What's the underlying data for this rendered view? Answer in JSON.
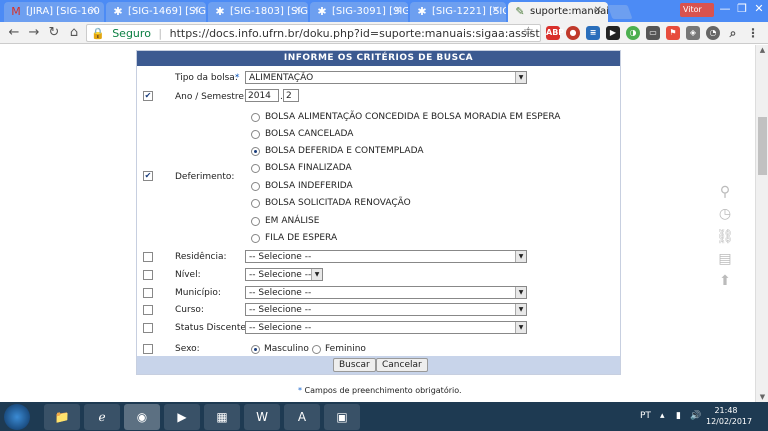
{
  "browser": {
    "tabs": [
      {
        "label": "[JIRA] [SIG-160",
        "icon": "gmail-icon",
        "active": false
      },
      {
        "label": "[SIG-1469] [SIG",
        "icon": "jira-icon",
        "active": false
      },
      {
        "label": "[SIG-1803] [SIG",
        "icon": "jira-icon",
        "active": false
      },
      {
        "label": "[SIG-3091] [SIG",
        "icon": "jira-icon",
        "active": false
      },
      {
        "label": "[SIG-1221] [SIG",
        "icon": "jira-icon",
        "active": false
      },
      {
        "label": "suporte:manuais",
        "icon": "doku-icon",
        "active": true
      }
    ],
    "profile_label": "Vitor",
    "secure_label": "Seguro",
    "url": "https://docs.info.ufrn.br/doku.php?id=suporte:manuais:sigaa:assistencia_ao_estudante"
  },
  "form": {
    "header": "INFORME OS CRITÉRIOS DE BUSCA",
    "tipo_bolsa": {
      "label": "Tipo da bolsa:",
      "value": "ALIMENTAÇÃO"
    },
    "ano_semestre": {
      "label": "Ano / Semestre:",
      "ano": "2014",
      "semestre": "2",
      "separator": ".",
      "checked": true
    },
    "deferimento": {
      "label": "Deferimento:",
      "checked": true,
      "options": [
        "BOLSA ALIMENTAÇÃO CONCEDIDA E BOLSA MORADIA EM ESPERA",
        "BOLSA CANCELADA",
        "BOLSA DEFERIDA E CONTEMPLADA",
        "BOLSA FINALIZADA",
        "BOLSA INDEFERIDA",
        "BOLSA SOLICITADA RENOVAÇÃO",
        "EM ANÁLISE",
        "FILA DE ESPERA"
      ],
      "selected_index": 2
    },
    "residencia": {
      "label": "Residência:",
      "value": "-- Selecione --"
    },
    "nivel": {
      "label": "Nível:",
      "value": "-- Selecione --"
    },
    "municipio": {
      "label": "Município:",
      "value": "-- Selecione --"
    },
    "curso": {
      "label": "Curso:",
      "value": "-- Selecione --"
    },
    "status_discente": {
      "label": "Status Discente:",
      "value": "-- Selecione --"
    },
    "sexo": {
      "label": "Sexo:",
      "option_m": "Masculino",
      "option_f": "Feminino",
      "selected": "Masculino"
    },
    "buttons": {
      "buscar": "Buscar",
      "cancelar": "Cancelar"
    },
    "footnote": "Campos de preenchimento obrigatório.",
    "required_mark": "*"
  },
  "taskbar": {
    "time": "21:48",
    "date": "12/02/2017",
    "language": "PT"
  }
}
